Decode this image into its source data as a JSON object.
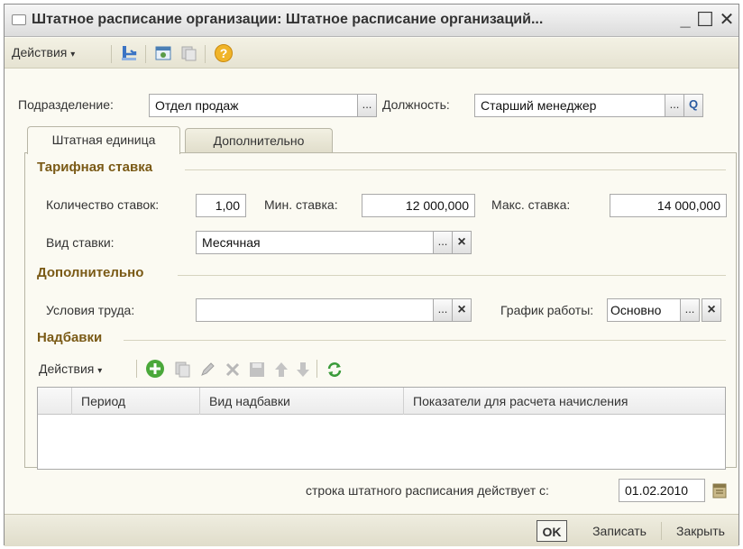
{
  "window": {
    "title": "Штатное расписание организации: Штатное расписание организаций...",
    "minimize": "_",
    "maximize": "☐",
    "close": "✕"
  },
  "toolbar": {
    "actions_label": "Действия",
    "help_icon": "?"
  },
  "header": {
    "department_label": "Подразделение:",
    "department_value": "Отдел продаж",
    "position_label": "Должность:",
    "position_value": "Старший менеджер",
    "ellipsis": "...",
    "search_glyph": "Q"
  },
  "tabs": [
    {
      "label": "Штатная единица",
      "active": true
    },
    {
      "label": "Дополнительно",
      "active": false
    }
  ],
  "tariff": {
    "section_title": "Тарифная ставка",
    "count_label": "Количество ставок:",
    "count_value": "1,00",
    "min_label": "Мин. ставка:",
    "min_value": "12 000,000",
    "max_label": "Макс. ставка:",
    "max_value": "14 000,000",
    "type_label": "Вид ставки:",
    "type_value": "Месячная",
    "ellipsis": "...",
    "clear": "×"
  },
  "additional": {
    "section_title": "Дополнительно",
    "conditions_label": "Условия труда:",
    "conditions_value": "",
    "schedule_label": "График работы:",
    "schedule_value": "Основно",
    "ellipsis": "...",
    "clear": "×"
  },
  "allowances": {
    "section_title": "Надбавки",
    "actions_label": "Действия",
    "columns": [
      "Период",
      "Вид надбавки",
      "Показатели для расчета начисления"
    ]
  },
  "footer": {
    "effective_label": "строка штатного расписания действует с:",
    "effective_date": "01.02.2010",
    "ok": "OK",
    "save": "Записать",
    "close": "Закрыть"
  },
  "colors": {
    "section_title": "#7a5a16",
    "background": "#fbfaf2"
  }
}
